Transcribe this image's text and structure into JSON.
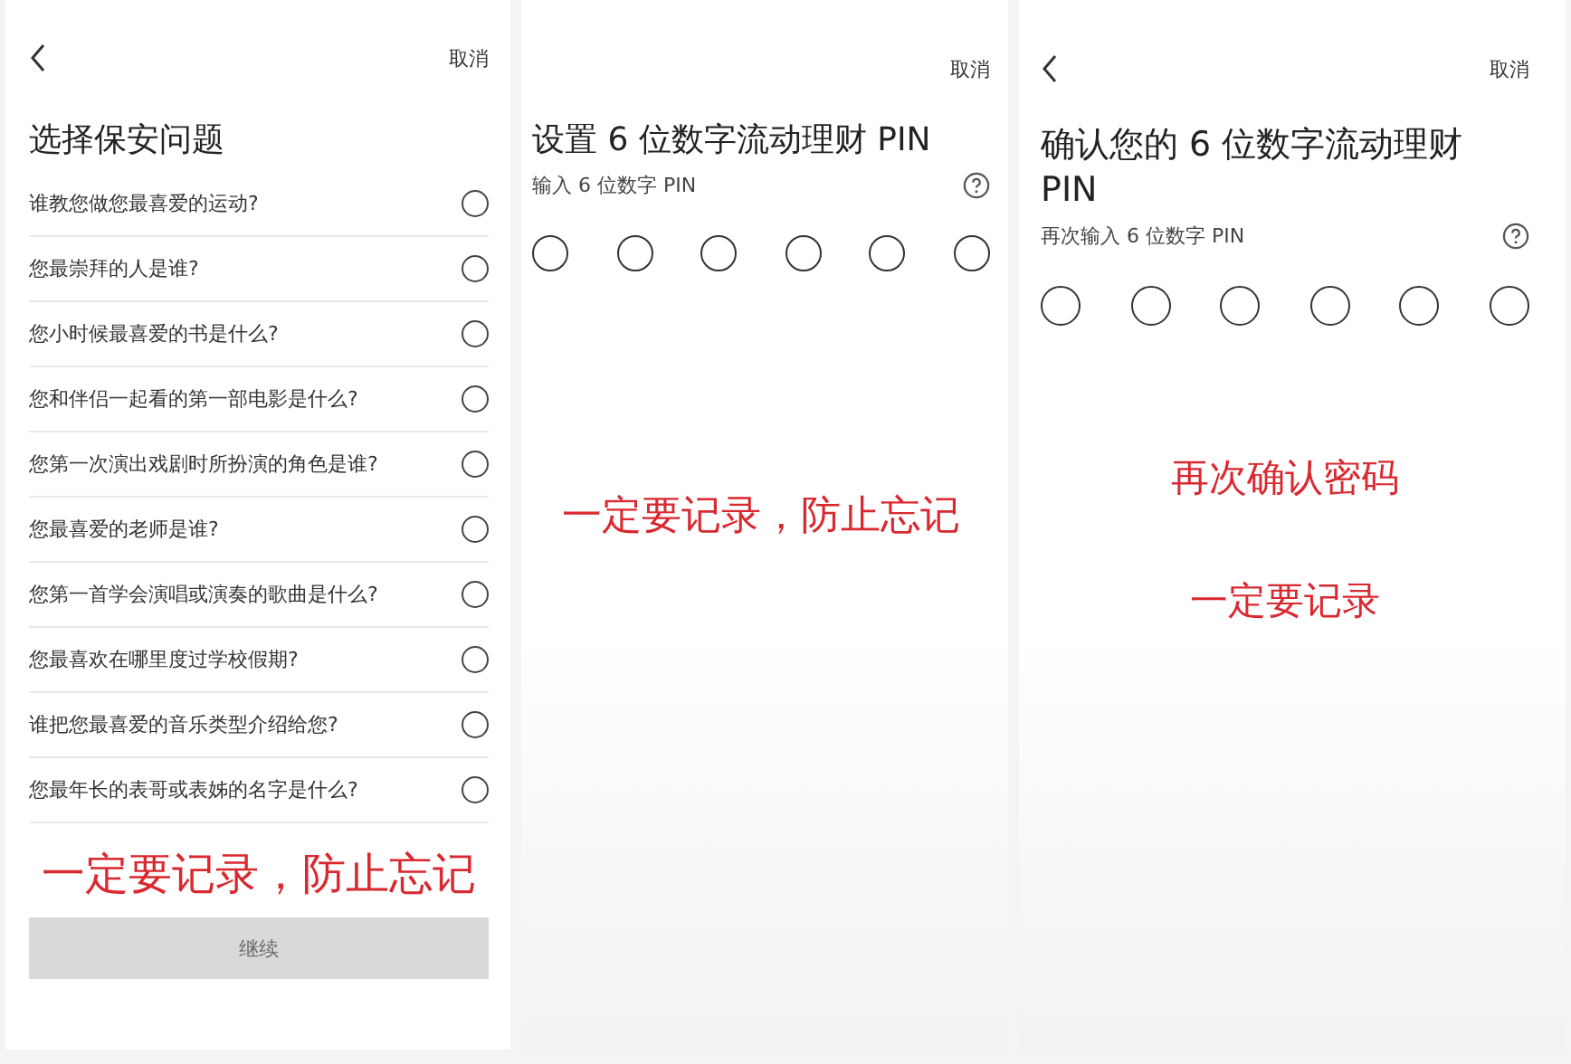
{
  "panels": [
    {
      "kind": "questions",
      "back": true,
      "cancel": "取消",
      "title": "选择保安问题",
      "questions": [
        {
          "text": "谁教您做您最喜爱的运动?",
          "selected": false
        },
        {
          "text": "您最崇拜的人是谁?",
          "selected": false
        },
        {
          "text": "您小时候最喜爱的书是什么?",
          "selected": false
        },
        {
          "text": "您和伴侣一起看的第一部电影是什么?",
          "selected": false
        },
        {
          "text": "您第一次演出戏剧时所扮演的角色是谁?",
          "selected": false
        },
        {
          "text": "您最喜爱的老师是谁?",
          "selected": false
        },
        {
          "text": "您第一首学会演唱或演奏的歌曲是什么?",
          "selected": false
        },
        {
          "text": "您最喜欢在哪里度过学校假期?",
          "selected": false
        },
        {
          "text": "谁把您最喜爱的音乐类型介绍给您?",
          "selected": false
        },
        {
          "text": "您最年长的表哥或表姊的名字是什么?",
          "selected": false
        }
      ],
      "notes": [
        "一定要记录，防止忘记"
      ],
      "button": {
        "label": "继续",
        "disabled": true
      }
    },
    {
      "kind": "pin",
      "back": false,
      "cancel": "取消",
      "title": "设置 6 位数字流动理财 PIN",
      "subtitle": "输入 6 位数字 PIN",
      "digits": [
        {
          "filled": false
        },
        {
          "filled": false
        },
        {
          "filled": false
        },
        {
          "filled": false
        },
        {
          "filled": false
        },
        {
          "filled": false
        }
      ],
      "notes": [
        "一定要记录，防止忘记"
      ]
    },
    {
      "kind": "pin",
      "back": true,
      "cancel": "取消",
      "title": "确认您的 6 位数字流动理财 PIN",
      "subtitle": "再次输入 6 位数字 PIN",
      "digits": [
        {
          "filled": false
        },
        {
          "filled": false
        },
        {
          "filled": false
        },
        {
          "filled": false
        },
        {
          "filled": false
        },
        {
          "filled": false
        }
      ],
      "notes": [
        "再次确认密码",
        "一定要记录"
      ]
    }
  ]
}
